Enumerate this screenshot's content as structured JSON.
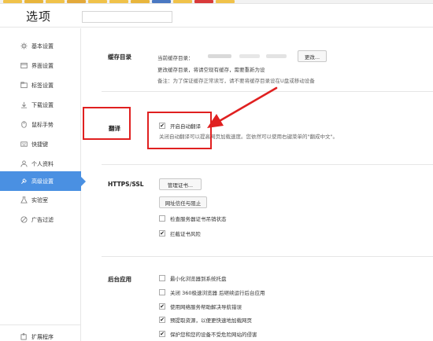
{
  "header": {
    "title": "选项"
  },
  "sidebar": {
    "items": [
      {
        "label": "基本设置",
        "icon": "gear-icon"
      },
      {
        "label": "界面设置",
        "icon": "window-icon"
      },
      {
        "label": "标签设置",
        "icon": "tab-icon"
      },
      {
        "label": "下载设置",
        "icon": "download-icon"
      },
      {
        "label": "鼠标手势",
        "icon": "mouse-icon"
      },
      {
        "label": "快捷键",
        "icon": "keyboard-icon"
      },
      {
        "label": "个人资料",
        "icon": "user-icon"
      },
      {
        "label": "高级设置",
        "icon": "wrench-icon",
        "active": true
      },
      {
        "label": "实验室",
        "icon": "flask-icon"
      },
      {
        "label": "广告过滤",
        "icon": "block-icon"
      }
    ],
    "bottom_item": {
      "label": "扩展程序",
      "icon": "puzzle-icon"
    }
  },
  "cache": {
    "title": "缓存目录",
    "current_label": "当前缓存目录：",
    "change_button": "更改...",
    "line2": "更改缓存目录，将请空现有缓存，需要重新为设",
    "note": "备注：为了保证缓存正常读写，请不要将缓存目录设在U盘或移动设备"
  },
  "translate": {
    "title": "翻译",
    "checkbox_label": "开启自动翻译",
    "checked": true,
    "description": "关闭自动翻译可以提高网页加载速度。您依然可以使用右键菜单的\"翻成中文\"。"
  },
  "https": {
    "title": "HTTPS/SSL",
    "manage_cert_button": "管理证书...",
    "network_trust_button": "网址信任与阻止",
    "check_revocation": {
      "label": "检查服务器证书吊销状态",
      "checked": false
    },
    "intercept_risk": {
      "label": "拦截证书风险",
      "checked": true
    }
  },
  "background": {
    "title": "后台应用",
    "items": [
      {
        "label": "最小化浏览器到系统托盘",
        "checked": false
      },
      {
        "label": "关闭 360极速浏览器 后继续运行后台应用",
        "checked": false
      },
      {
        "label": "使用网络服务帮助解决导航错误",
        "checked": true
      },
      {
        "label": "预提取资源，以便更快速地加载网页",
        "checked": true
      },
      {
        "label": "保护您和您的设备不受危险网站的侵害",
        "checked": true
      }
    ]
  },
  "colors": {
    "accent": "#4a90e2",
    "annotation": "#e02020"
  }
}
